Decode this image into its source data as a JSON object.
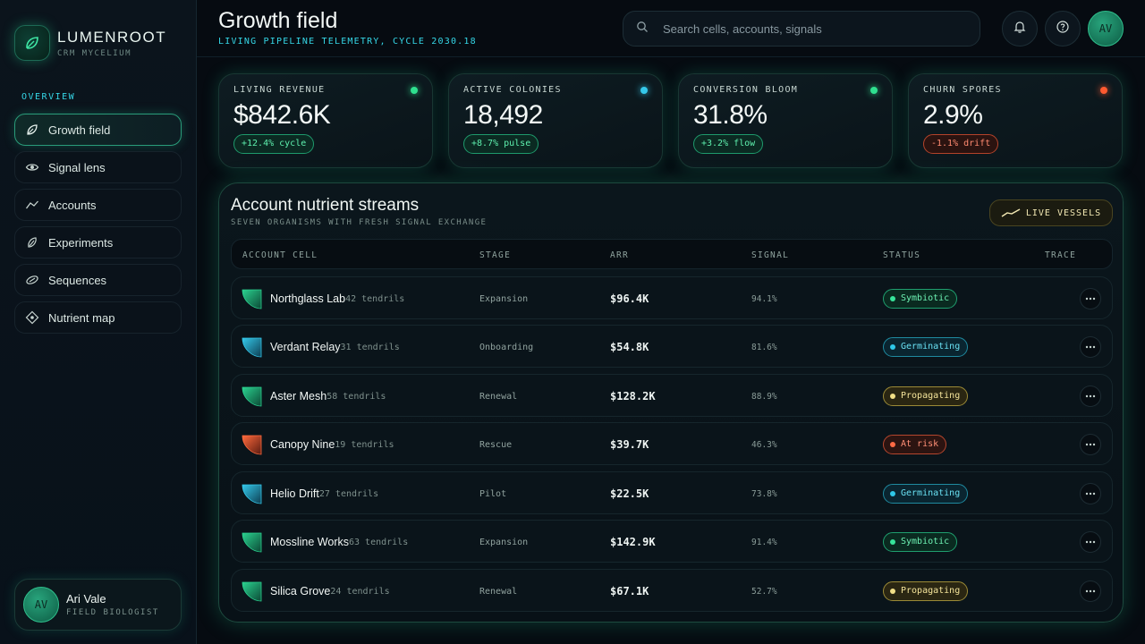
{
  "brand": {
    "name": "LUMENROOT",
    "subtitle": "CRM MYCELIUM"
  },
  "nav": {
    "heading": "OVERVIEW",
    "items": [
      {
        "label": "Growth field",
        "icon": "leaf-icon",
        "active": true
      },
      {
        "label": "Signal lens",
        "icon": "eye-icon",
        "active": false
      },
      {
        "label": "Accounts",
        "icon": "trend-icon",
        "active": false
      },
      {
        "label": "Experiments",
        "icon": "flask-leaf-icon",
        "active": false
      },
      {
        "label": "Sequences",
        "icon": "orbit-icon",
        "active": false
      },
      {
        "label": "Nutrient map",
        "icon": "diamond-icon",
        "active": false
      }
    ]
  },
  "user": {
    "initials": "AV",
    "name": "Ari Vale",
    "role": "FIELD BIOLOGIST"
  },
  "header": {
    "title": "Growth field",
    "subtitle": "LIVING PIPELINE TELEMETRY, CYCLE 2030.18",
    "search_placeholder": "Search cells, accounts, signals",
    "avatar_initials": "AV"
  },
  "kpis": [
    {
      "label": "LIVING REVENUE",
      "value": "$842.6K",
      "delta": "+12.4% cycle",
      "dot_color": "#2fe08f",
      "trend": "up"
    },
    {
      "label": "ACTIVE COLONIES",
      "value": "18,492",
      "delta": "+8.7% pulse",
      "dot_color": "#35c8ea",
      "trend": "up"
    },
    {
      "label": "CONVERSION BLOOM",
      "value": "31.8%",
      "delta": "+3.2% flow",
      "dot_color": "#2fe08f",
      "trend": "up"
    },
    {
      "label": "CHURN SPORES",
      "value": "2.9%",
      "delta": "-1.1% drift",
      "dot_color": "#ff5a30",
      "trend": "down"
    }
  ],
  "panel": {
    "title": "Account nutrient streams",
    "subtitle": "SEVEN ORGANISMS WITH FRESH SIGNAL EXCHANGE",
    "live_button": "LIVE VESSELS",
    "columns": [
      "ACCOUNT CELL",
      "STAGE",
      "ARR",
      "SIGNAL",
      "STATUS",
      "TRACE"
    ],
    "rows": [
      {
        "name": "Northglass Lab",
        "tendrils": "42 tendrils",
        "stage": "Expansion",
        "arr": "$96.4K",
        "signal": "94.1%",
        "status": "Symbiotic",
        "tone": "green"
      },
      {
        "name": "Verdant Relay",
        "tendrils": "31 tendrils",
        "stage": "Onboarding",
        "arr": "$54.8K",
        "signal": "81.6%",
        "status": "Germinating",
        "tone": "cyan"
      },
      {
        "name": "Aster Mesh",
        "tendrils": "58 tendrils",
        "stage": "Renewal",
        "arr": "$128.2K",
        "signal": "88.9%",
        "status": "Propagating",
        "tone": "yellow"
      },
      {
        "name": "Canopy Nine",
        "tendrils": "19 tendrils",
        "stage": "Rescue",
        "arr": "$39.7K",
        "signal": "46.3%",
        "status": "At risk",
        "tone": "red"
      },
      {
        "name": "Helio Drift",
        "tendrils": "27 tendrils",
        "stage": "Pilot",
        "arr": "$22.5K",
        "signal": "73.8%",
        "status": "Germinating",
        "tone": "cyan"
      },
      {
        "name": "Mossline Works",
        "tendrils": "63 tendrils",
        "stage": "Expansion",
        "arr": "$142.9K",
        "signal": "91.4%",
        "status": "Symbiotic",
        "tone": "green"
      },
      {
        "name": "Silica Grove",
        "tendrils": "24 tendrils",
        "stage": "Renewal",
        "arr": "$67.1K",
        "signal": "52.7%",
        "status": "Propagating",
        "tone": "yellow"
      }
    ]
  },
  "colors": {
    "accent_green": "#2fe08f",
    "accent_cyan": "#35d6e6",
    "danger": "#ff5a30",
    "warning": "#f2df86"
  }
}
